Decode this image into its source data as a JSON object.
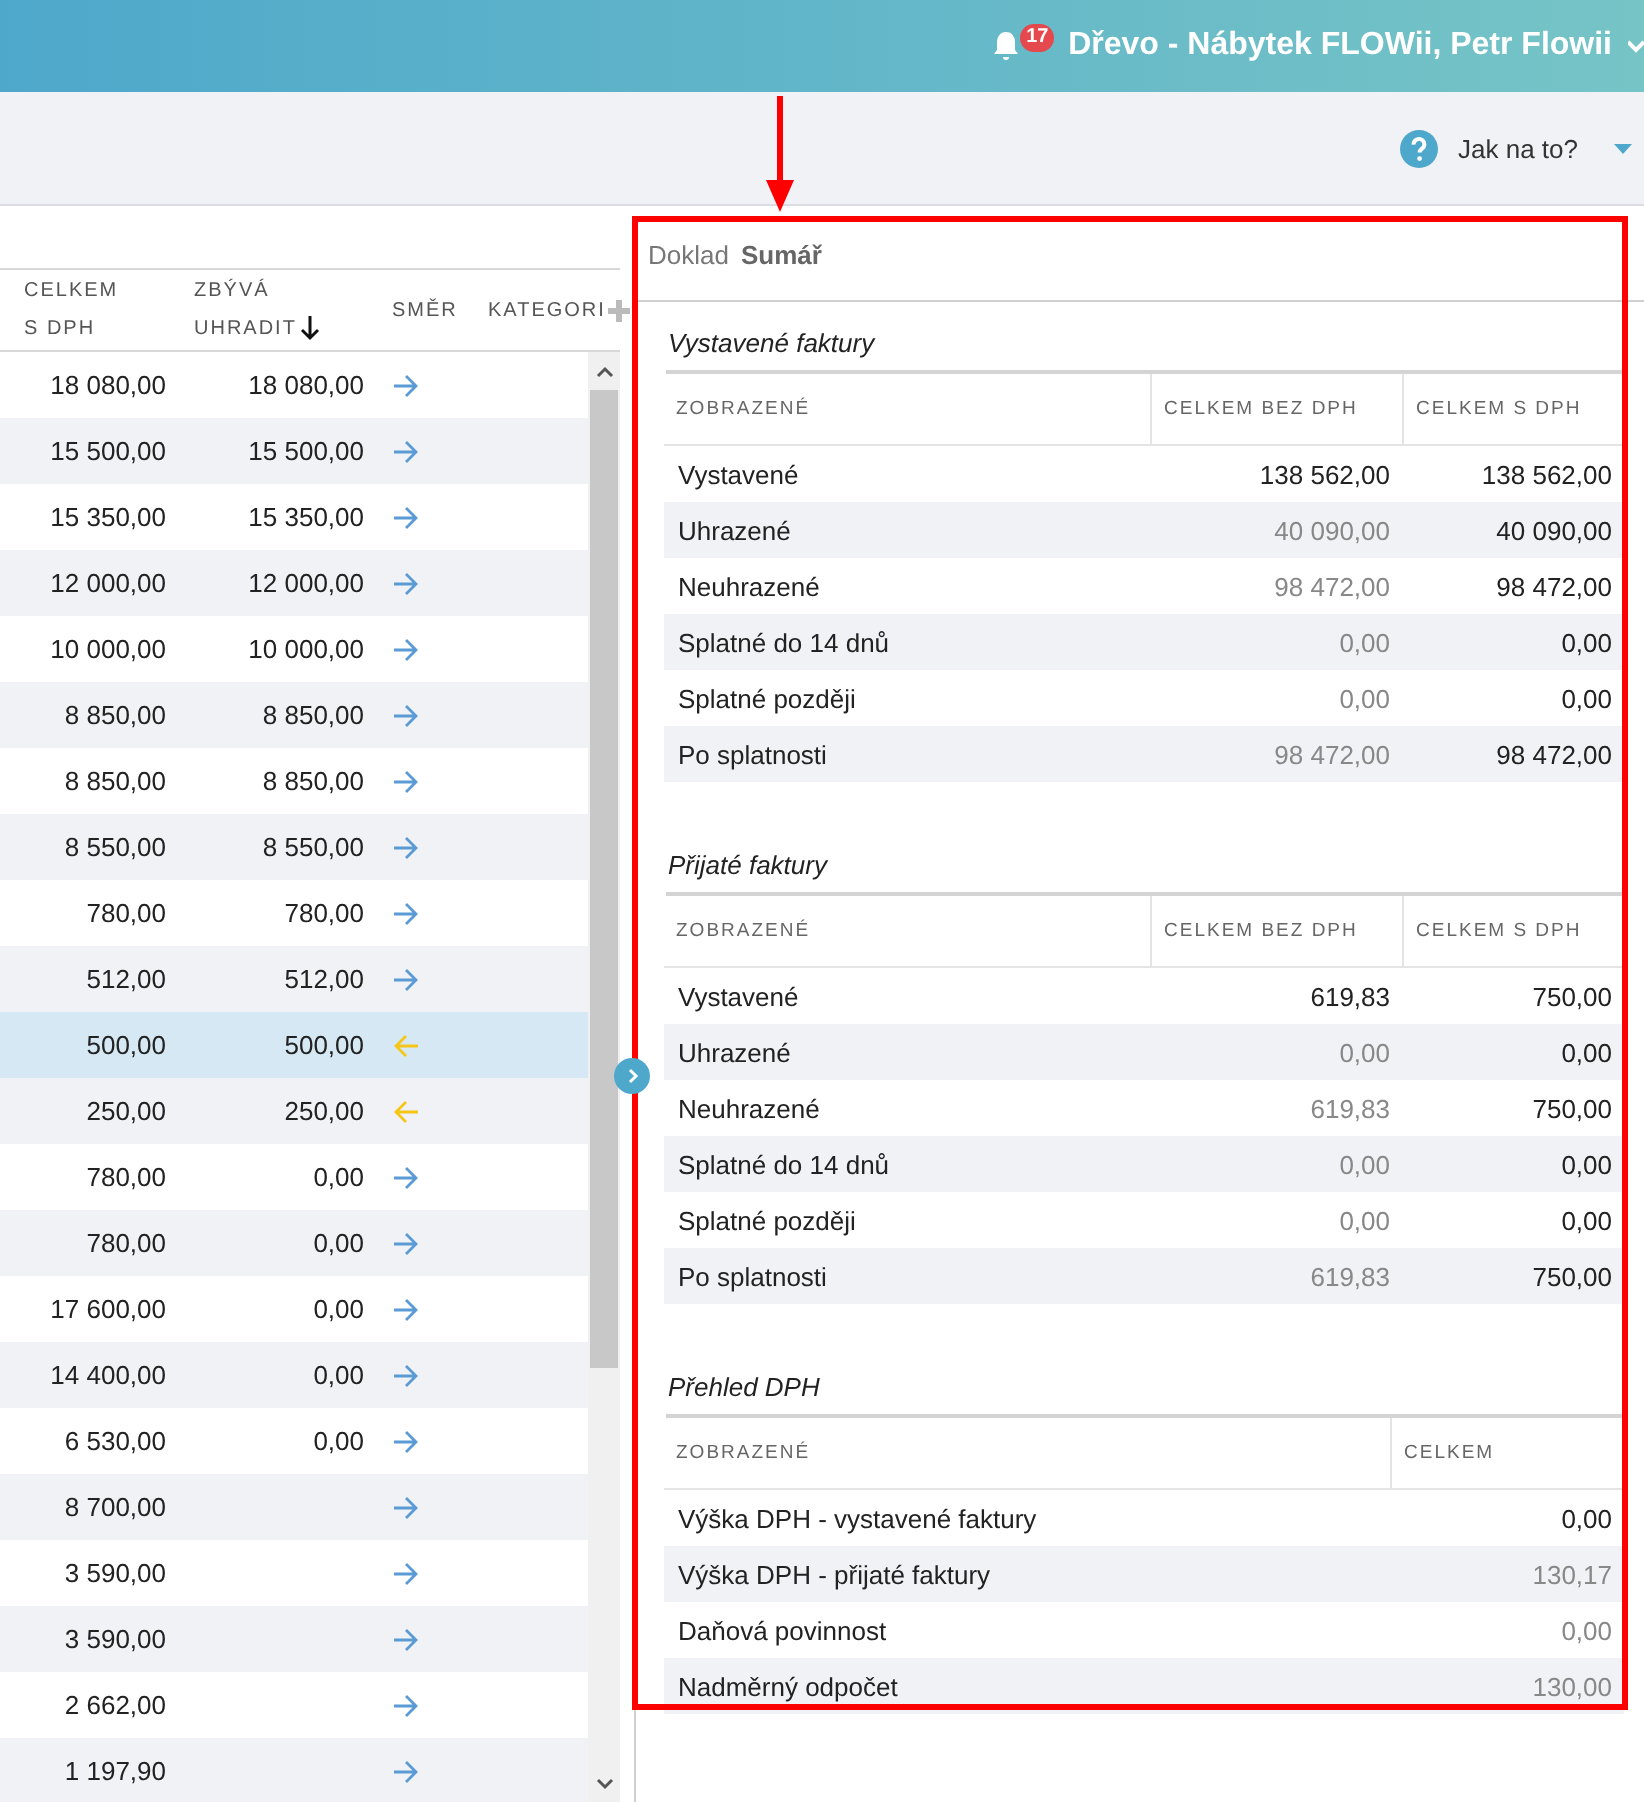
{
  "header": {
    "notifications": "17",
    "title": "Dřevo - Nábytek FLOWii, Petr Flowii"
  },
  "toolbar": {
    "help_label": "Jak na to?"
  },
  "invoice_table": {
    "columns": [
      {
        "label": "CELKEM S DPH",
        "sorted": false
      },
      {
        "label": "ZBÝVÁ UHRADIT",
        "sorted": true
      },
      {
        "label": "SMĚR",
        "sorted": false
      },
      {
        "label": "KATEGORI",
        "sorted": false
      }
    ],
    "rows": [
      {
        "total": "18 080,00",
        "remaining": "18 080,00",
        "kind": "out",
        "selected": false
      },
      {
        "total": "15 500,00",
        "remaining": "15 500,00",
        "kind": "out",
        "selected": false
      },
      {
        "total": "15 350,00",
        "remaining": "15 350,00",
        "kind": "out",
        "selected": false
      },
      {
        "total": "12 000,00",
        "remaining": "12 000,00",
        "kind": "out",
        "selected": false
      },
      {
        "total": "10 000,00",
        "remaining": "10 000,00",
        "kind": "out",
        "selected": false
      },
      {
        "total": "8 850,00",
        "remaining": "8 850,00",
        "kind": "out",
        "selected": false
      },
      {
        "total": "8 850,00",
        "remaining": "8 850,00",
        "kind": "out",
        "selected": false
      },
      {
        "total": "8 550,00",
        "remaining": "8 550,00",
        "kind": "out",
        "selected": false
      },
      {
        "total": "780,00",
        "remaining": "780,00",
        "kind": "out",
        "selected": false
      },
      {
        "total": "512,00",
        "remaining": "512,00",
        "kind": "out",
        "selected": false
      },
      {
        "total": "500,00",
        "remaining": "500,00",
        "kind": "in",
        "selected": true
      },
      {
        "total": "250,00",
        "remaining": "250,00",
        "kind": "in",
        "selected": false
      },
      {
        "total": "780,00",
        "remaining": "0,00",
        "kind": "out",
        "selected": false
      },
      {
        "total": "780,00",
        "remaining": "0,00",
        "kind": "out",
        "selected": false
      },
      {
        "total": "17 600,00",
        "remaining": "0,00",
        "kind": "out",
        "selected": false
      },
      {
        "total": "14 400,00",
        "remaining": "0,00",
        "kind": "out",
        "selected": false
      },
      {
        "total": "6 530,00",
        "remaining": "0,00",
        "kind": "out",
        "selected": false
      },
      {
        "total": "8 700,00",
        "kind": "out",
        "selected": false
      },
      {
        "total": "3 590,00",
        "kind": "out",
        "selected": false
      },
      {
        "total": "3 590,00",
        "kind": "out",
        "selected": false
      },
      {
        "total": "2 662,00",
        "kind": "out",
        "selected": false
      },
      {
        "total": "1 197,90",
        "kind": "out",
        "selected": false
      }
    ]
  },
  "panel": {
    "tabs": [
      {
        "label": "Doklad",
        "selected": false
      },
      {
        "label": "Sumář",
        "selected": true
      }
    ],
    "sections": [
      {
        "title": "Vystavené faktury",
        "columns": [
          "ZOBRAZENÉ",
          "CELKEM BEZ DPH",
          "CELKEM S DPH"
        ],
        "rows": [
          {
            "label": "Vystavené",
            "values": [
              {
                "text": "138 562,00",
                "muted": false
              },
              {
                "text": "138 562,00",
                "muted": false
              }
            ]
          },
          {
            "label": "Uhrazené",
            "values": [
              {
                "text": "40 090,00",
                "muted": true
              },
              {
                "text": "40 090,00",
                "muted": false
              }
            ]
          },
          {
            "label": "Neuhrazené",
            "values": [
              {
                "text": "98 472,00",
                "muted": true
              },
              {
                "text": "98 472,00",
                "muted": false
              }
            ]
          },
          {
            "label": "Splatné do 14 dnů",
            "values": [
              {
                "text": "0,00",
                "muted": true
              },
              {
                "text": "0,00",
                "muted": false
              }
            ]
          },
          {
            "label": "Splatné později",
            "values": [
              {
                "text": "0,00",
                "muted": true
              },
              {
                "text": "0,00",
                "muted": false
              }
            ]
          },
          {
            "label": "Po splatnosti",
            "values": [
              {
                "text": "98 472,00",
                "muted": true
              },
              {
                "text": "98 472,00",
                "muted": false
              }
            ]
          }
        ]
      },
      {
        "title": "Přijaté faktury",
        "columns": [
          "ZOBRAZENÉ",
          "CELKEM BEZ DPH",
          "CELKEM S DPH"
        ],
        "rows": [
          {
            "label": "Vystavené",
            "values": [
              {
                "text": "619,83",
                "muted": false
              },
              {
                "text": "750,00",
                "muted": false
              }
            ]
          },
          {
            "label": "Uhrazené",
            "values": [
              {
                "text": "0,00",
                "muted": true
              },
              {
                "text": "0,00",
                "muted": false
              }
            ]
          },
          {
            "label": "Neuhrazené",
            "values": [
              {
                "text": "619,83",
                "muted": true
              },
              {
                "text": "750,00",
                "muted": false
              }
            ]
          },
          {
            "label": "Splatné do 14 dnů",
            "values": [
              {
                "text": "0,00",
                "muted": true
              },
              {
                "text": "0,00",
                "muted": false
              }
            ]
          },
          {
            "label": "Splatné později",
            "values": [
              {
                "text": "0,00",
                "muted": true
              },
              {
                "text": "0,00",
                "muted": false
              }
            ]
          },
          {
            "label": "Po splatnosti",
            "values": [
              {
                "text": "619,83",
                "muted": true
              },
              {
                "text": "750,00",
                "muted": false
              }
            ]
          }
        ]
      },
      {
        "title": "Přehled DPH",
        "columns": [
          "ZOBRAZENÉ",
          "CELKEM"
        ],
        "rows": [
          {
            "label": "Výška DPH - vystavené faktury",
            "values": [
              {
                "text": "0,00",
                "muted": false
              }
            ]
          },
          {
            "label": "Výška DPH - přijaté faktury",
            "values": [
              {
                "text": "130,17",
                "muted": true
              }
            ]
          },
          {
            "label": "Daňová povinnost",
            "values": [
              {
                "text": "0,00",
                "muted": true
              }
            ]
          },
          {
            "label": "Nadměrný odpočet",
            "values": [
              {
                "text": "130,00",
                "muted": true
              }
            ]
          }
        ]
      }
    ]
  }
}
